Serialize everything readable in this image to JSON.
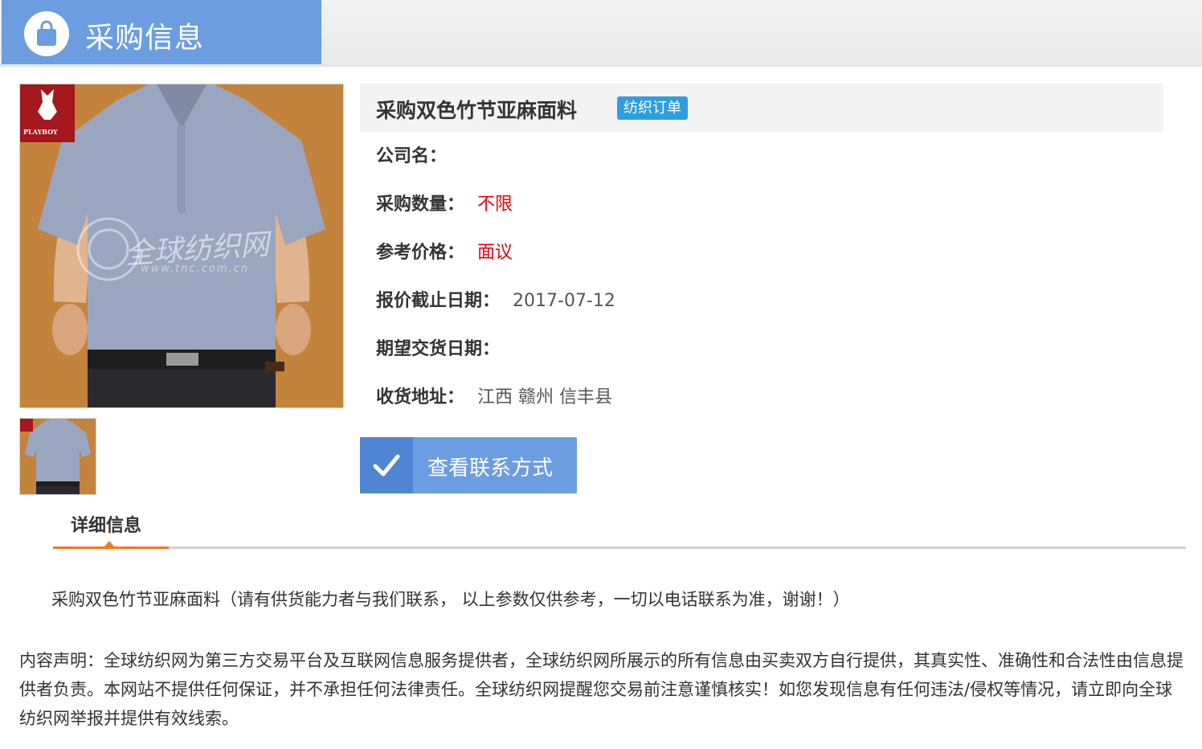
{
  "header": {
    "title": "采购信息"
  },
  "product": {
    "title": "采购双色竹节亚麻面料",
    "tag": "纺织订单",
    "brand_logo_text": "PLAYBOY",
    "watermark_text": "全球纺织网",
    "watermark_url": "www.tnc.com.cn"
  },
  "info": {
    "company_label": "公司名：",
    "company_value": "",
    "quantity_label": "采购数量：",
    "quantity_value": "不限",
    "price_label": "参考价格：",
    "price_value": "面议",
    "deadline_label": "报价截止日期：",
    "deadline_value": "2017-07-12",
    "delivery_label": "期望交货日期：",
    "delivery_value": "",
    "address_label": "收货地址：",
    "address_value": "江西 赣州 信丰县"
  },
  "contact_button": {
    "label": "查看联系方式"
  },
  "detail_tab": {
    "label": "详细信息"
  },
  "description": "采购双色竹节亚麻面料（请有供货能力者与我们联系， 以上参数仅供参考，一切以电话联系为准，谢谢！）",
  "disclaimer": "内容声明：全球纺织网为第三方交易平台及互联网信息服务提供者，全球纺织网所展示的所有信息由买卖双方自行提供，其真实性、准确性和合法性由信息提供者负责。本网站不提供任何保证，并不承担任何法律责任。全球纺织网提醒您交易前注意谨慎核实！如您发现信息有任何违法/侵权等情况，请立即向全球纺织网举报并提供有效线索。",
  "colors": {
    "header_blue": "#6b9de0",
    "tag_blue": "#2f9ee0",
    "value_red": "#e4000e",
    "tab_orange": "#f07a1a",
    "image_background": "#c4833d"
  }
}
